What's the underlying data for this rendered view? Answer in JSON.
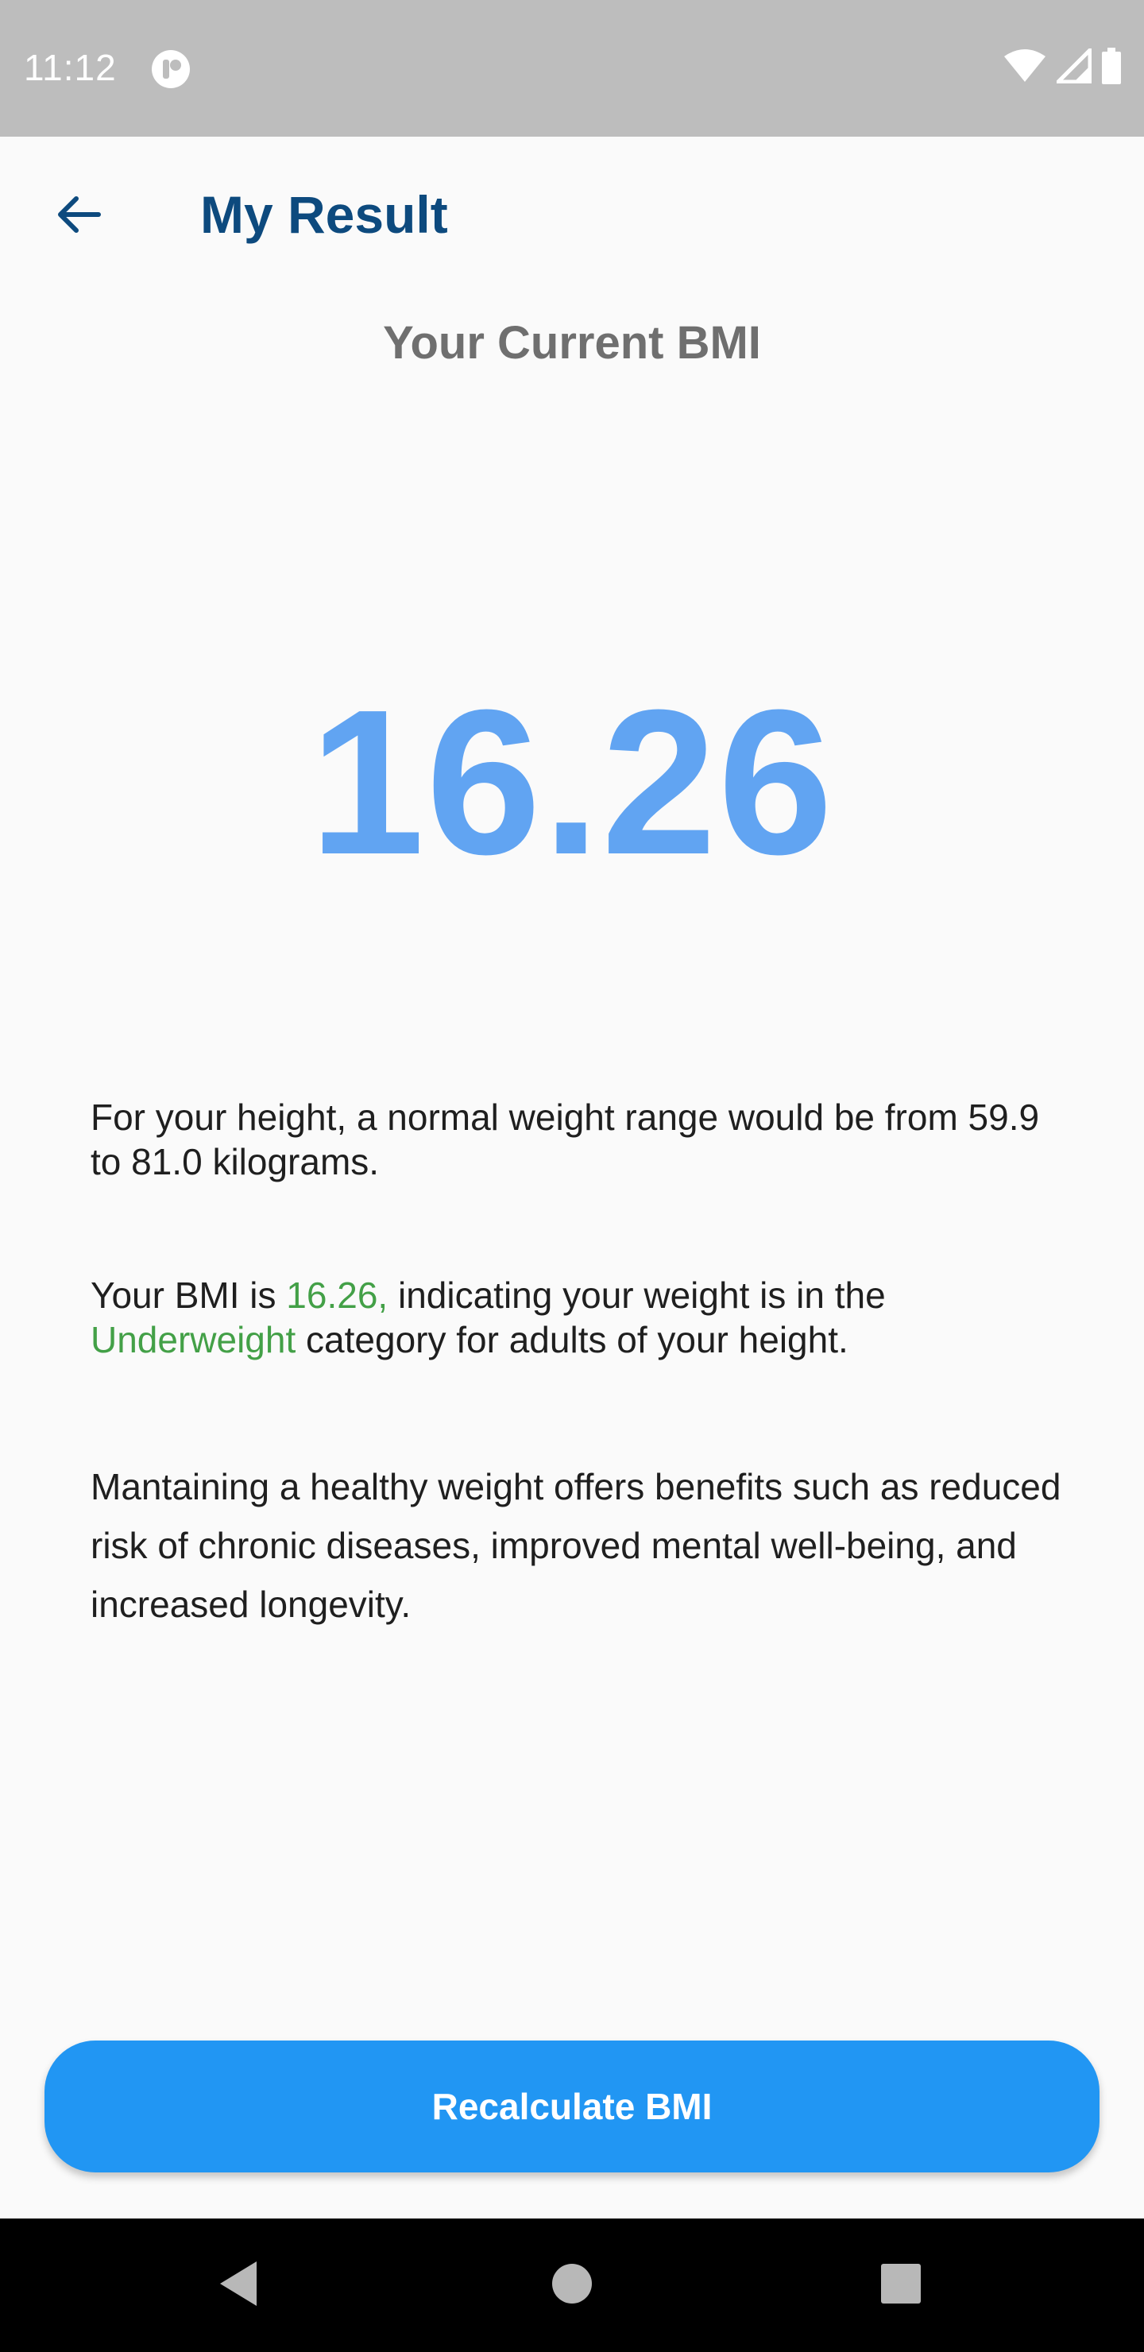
{
  "status_bar": {
    "time": "11:12",
    "icons": [
      "app-notification-icon",
      "wifi-icon",
      "cellular-signal-icon",
      "battery-icon"
    ]
  },
  "app_bar": {
    "title": "My Result",
    "back_icon": "arrow-back-icon"
  },
  "result": {
    "heading": "Your Current BMI",
    "bmi_value": "16.26",
    "range_text": "For your height, a normal weight range would be from 59.9 to 81.0 kilograms.",
    "category_prefix": "Your BMI is ",
    "category_bmi": "16.26,",
    "category_middle": " indicating your weight is in the ",
    "category_name": "Underweight",
    "category_suffix": " category for adults of your height.",
    "benefits_text": "Mantaining a healthy weight offers benefits such as reduced risk of chronic diseases, improved mental well-being, and increased longevity."
  },
  "actions": {
    "recalculate_label": "Recalculate BMI"
  },
  "nav_bar": {
    "buttons": [
      "back-triangle-icon",
      "home-circle-icon",
      "recents-square-icon"
    ]
  },
  "colors": {
    "title": "#0d4a7e",
    "bmi_value": "#61a4f2",
    "highlight": "#43a047",
    "button": "#2196f3",
    "status_bar": "#bdbdbd"
  }
}
